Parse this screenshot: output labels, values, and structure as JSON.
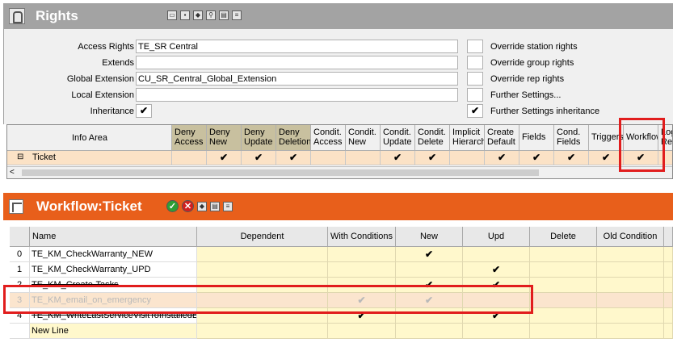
{
  "rights_panel": {
    "title": "Rights",
    "toolbar_icons": [
      "folder-icon",
      "save-icon",
      "eraser-icon",
      "search-key-icon",
      "print-icon",
      "document-icon"
    ]
  },
  "form": {
    "access_rights": {
      "label": "Access Rights",
      "value": "TE_SR Central"
    },
    "extends": {
      "label": "Extends",
      "value": ""
    },
    "global_extension": {
      "label": "Global Extension",
      "value": "CU_SR_Central_Global_Extension"
    },
    "local_extension": {
      "label": "Local Extension",
      "value": ""
    },
    "inheritance": {
      "label": "Inheritance",
      "value": "✔"
    },
    "options": [
      {
        "label": "Override station rights",
        "value": ""
      },
      {
        "label": "Override group rights",
        "value": ""
      },
      {
        "label": "Override rep rights",
        "value": ""
      },
      {
        "label": "Further Settings...",
        "value": ""
      },
      {
        "label": "Further Settings inheritance",
        "value": "✔"
      }
    ]
  },
  "rights_grid": {
    "headers": [
      {
        "l1": "Info Area",
        "l2": ""
      },
      {
        "l1": "Deny",
        "l2": "Access"
      },
      {
        "l1": "Deny",
        "l2": "New"
      },
      {
        "l1": "Deny",
        "l2": "Update"
      },
      {
        "l1": "Deny",
        "l2": "Deletion"
      },
      {
        "l1": "Condit.",
        "l2": "Access"
      },
      {
        "l1": "Condit.",
        "l2": "New"
      },
      {
        "l1": "Condit.",
        "l2": "Update"
      },
      {
        "l1": "Condit.",
        "l2": "Delete"
      },
      {
        "l1": "Implicit",
        "l2": "Hierarch"
      },
      {
        "l1": "Create",
        "l2": "Default"
      },
      {
        "l1": "Fields",
        "l2": ""
      },
      {
        "l1": "Cond.",
        "l2": "Fields"
      },
      {
        "l1": "Triggers",
        "l2": ""
      },
      {
        "l1": "Workflow",
        "l2": ""
      },
      {
        "l1": "Log",
        "l2": "Rea"
      }
    ],
    "row": {
      "name": "Ticket",
      "tree_toggle": "⊟",
      "values": [
        "",
        "✔",
        "✔",
        "✔",
        "",
        "",
        "✔",
        "✔",
        "",
        "✔",
        "✔",
        "✔",
        "✔",
        "✔",
        ""
      ]
    },
    "scroll_left": "<"
  },
  "workflow_panel": {
    "title": "Workflow:Ticket",
    "toolbar_icons": [
      "ok-icon",
      "cancel-icon",
      "eraser-icon",
      "print-icon",
      "document-icon"
    ]
  },
  "workflow_table": {
    "headers": [
      "Name",
      "Dependent",
      "With Conditions",
      "New",
      "Upd",
      "Delete",
      "Old Condition"
    ],
    "rows": [
      {
        "num": "0",
        "name": "TE_KM_CheckWarranty_NEW",
        "dep": "",
        "cond": "",
        "new": "✔",
        "upd": "",
        "del": "",
        "old": ""
      },
      {
        "num": "1",
        "name": "TE_KM_CheckWarranty_UPD",
        "dep": "",
        "cond": "",
        "new": "",
        "upd": "✔",
        "del": "",
        "old": ""
      },
      {
        "num": "2",
        "name": "TE_KM_Create-Tasks",
        "dep": "",
        "cond": "",
        "new": "✔",
        "upd": "✔",
        "del": "",
        "old": ""
      },
      {
        "num": "3",
        "name": "TE_KM_email_on_emergency",
        "dep": "",
        "cond": "✔",
        "new": "✔",
        "upd": "",
        "del": "",
        "old": ""
      },
      {
        "num": "4",
        "name": "TE_KM_WriteLastServiceVisitToInstalledBa",
        "dep": "",
        "cond": "✔",
        "new": "",
        "upd": "✔",
        "del": "",
        "old": ""
      },
      {
        "num": "",
        "name": "New Line",
        "dep": "",
        "cond": "",
        "new": "",
        "upd": "",
        "del": "",
        "old": ""
      }
    ]
  },
  "colors": {
    "rights_header": "#a3a3a3",
    "workflow_header": "#e85f1b",
    "highlight_box": "#e11d1d",
    "cell_orange": "#fbe2c6",
    "cell_yellow": "#fff8cc"
  }
}
